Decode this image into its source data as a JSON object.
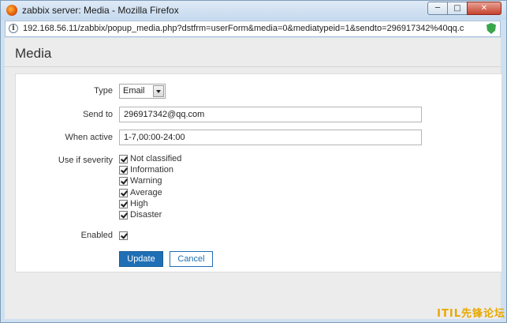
{
  "window": {
    "title": "zabbix server: Media - Mozilla Firefox",
    "controls": {
      "minimize": "─",
      "maximize": "□",
      "close": "✕"
    }
  },
  "urlbar": {
    "url": "192.168.56.11/zabbix/popup_media.php?dstfrm=userForm&media=0&mediatypeid=1&sendto=296917342%40qq.c"
  },
  "page": {
    "title": "Media"
  },
  "form": {
    "type": {
      "label": "Type",
      "value": "Email"
    },
    "send_to": {
      "label": "Send to",
      "value": "296917342@qq.com"
    },
    "when_active": {
      "label": "When active",
      "value": "1-7,00:00-24:00"
    },
    "severity": {
      "label": "Use if severity",
      "options": [
        {
          "label": "Not classified",
          "checked": true
        },
        {
          "label": "Information",
          "checked": true
        },
        {
          "label": "Warning",
          "checked": true
        },
        {
          "label": "Average",
          "checked": true
        },
        {
          "label": "High",
          "checked": true
        },
        {
          "label": "Disaster",
          "checked": true
        }
      ]
    },
    "enabled": {
      "label": "Enabled",
      "checked": true
    },
    "buttons": {
      "update": "Update",
      "cancel": "Cancel"
    }
  },
  "watermark": "ITIL先锋论坛",
  "colors": {
    "primary": "#1f6fb5",
    "watermark": "#e8a800"
  }
}
